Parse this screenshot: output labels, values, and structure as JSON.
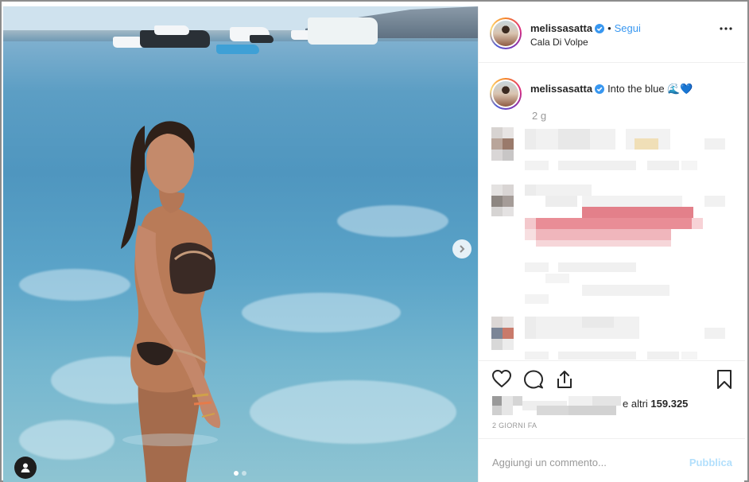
{
  "post": {
    "author": "melissasatta",
    "follow_label": "Segui",
    "location": "Cala Di Volpe",
    "caption_author": "melissasatta",
    "caption_text": "Into the blue 🌊💙",
    "caption_time": "2 g",
    "likes_suffix": "e altri ",
    "likes_count": "159.325",
    "posted_ago": "2 GIORNI FA",
    "comment_placeholder": "Aggiungi un commento...",
    "publish_label": "Pubblica",
    "carousel_dots": 2,
    "carousel_active": 1
  },
  "icons": {
    "verified": "verified-badge-icon",
    "more": "more-options-icon",
    "like": "heart-icon",
    "comment": "comment-icon",
    "share": "share-icon",
    "save": "bookmark-icon",
    "next": "chevron-right-icon",
    "user": "user-icon"
  },
  "colors": {
    "link": "#3897f0",
    "verified": "#3897f0",
    "publish_disabled": "#b2dffc",
    "muted": "#999999"
  }
}
